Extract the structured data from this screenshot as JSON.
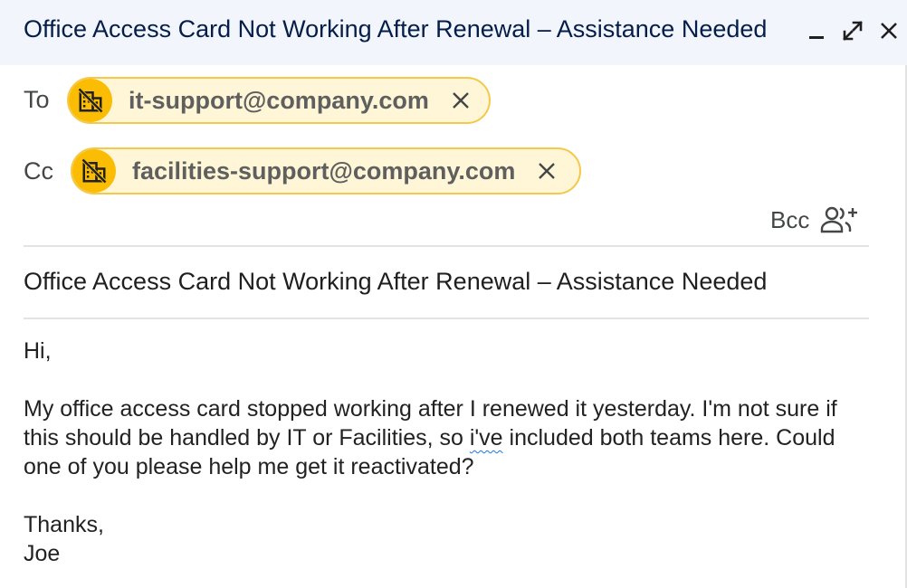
{
  "window": {
    "title": "Office Access Card Not Working After Renewal – Assistance Needed"
  },
  "recipients": {
    "to_label": "To",
    "to": [
      {
        "email": "it-support@company.com"
      }
    ],
    "cc_label": "Cc",
    "cc": [
      {
        "email": "facilities-support@company.com"
      }
    ],
    "bcc_label": "Bcc"
  },
  "subject": "Office Access Card Not Working After Renewal – Assistance Needed",
  "body": {
    "greeting": "Hi,",
    "para_before": "My office access card stopped working after I renewed it yesterday. I'm not sure if this should be handled by IT or Facilities, so ",
    "para_misspelled": "i've",
    "para_after": " included both teams here. Could one of you please help me get it reactivated?",
    "signoff": "Thanks,",
    "name": "Joe"
  },
  "icons": {
    "minimize": "minimize-icon",
    "expand": "expand-icon",
    "close": "close-icon",
    "group_avatar": "domain-disabled-icon",
    "remove": "remove-chip-icon",
    "add_people": "person-add-icon"
  },
  "colors": {
    "titlebar_bg": "#f2f6fc",
    "title_text": "#041e49",
    "chip_bg": "#fef6d6",
    "chip_border": "#f4c84a",
    "avatar_bg": "#fbbc04",
    "spellcheck": "#1a73e8"
  }
}
